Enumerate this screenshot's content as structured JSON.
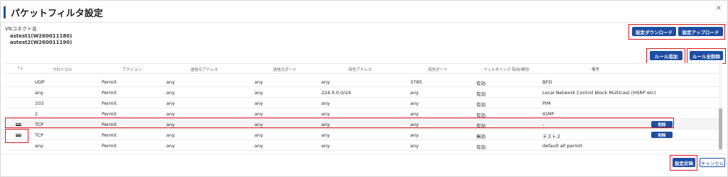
{
  "dialog": {
    "title": "パケットフィルタ設定",
    "close_label": "×"
  },
  "vn": {
    "label": "VNコネクト名",
    "items": [
      "astest1(W260011180)",
      "astest2(W260011190)"
    ]
  },
  "toolbar": {
    "download_label": "設定ダウンロード",
    "upload_label": "設定アップロード",
    "add_rule_label": "ルール追加",
    "delete_all_label": "ルール全削除"
  },
  "table": {
    "headers": {
      "sort": "↑↓",
      "protocol": "プロトコル",
      "action": "アクション",
      "src_addr": "送信元アドレス",
      "src_port": "送信元ポート",
      "dst_addr": "宛先アドレス",
      "dst_port": "宛先ポート",
      "filtering": "フィルタリング 有効/無効",
      "note": "備考"
    },
    "rows": [
      {
        "protocol": "UDP",
        "action": "Permit",
        "src_addr": "any",
        "src_port": "any",
        "dst_addr": "any",
        "dst_port": "3785",
        "filtering": "有効",
        "note": "BFD"
      },
      {
        "protocol": "any",
        "action": "Permit",
        "src_addr": "any",
        "src_port": "any",
        "dst_addr": "224.0.0.0/24",
        "dst_port": "any",
        "filtering": "有効",
        "note": "Local Network Control Block Multicast (HSRP etc)"
      },
      {
        "protocol": "103",
        "action": "Permit",
        "src_addr": "any",
        "src_port": "any",
        "dst_addr": "any",
        "dst_port": "any",
        "filtering": "有効",
        "note": "PIM"
      },
      {
        "protocol": "2",
        "action": "Permit",
        "src_addr": "any",
        "src_port": "any",
        "dst_addr": "any",
        "dst_port": "any",
        "filtering": "有効",
        "note": "IGMP"
      },
      {
        "protocol": "TCP",
        "action": "Permit",
        "src_addr": "any",
        "src_port": "any",
        "dst_addr": "any",
        "dst_port": "any",
        "filtering": "有効",
        "note": "-",
        "delete_label": "削除"
      },
      {
        "protocol": "TCP",
        "action": "Permit",
        "src_addr": "any",
        "src_port": "any",
        "dst_addr": "any",
        "dst_port": "any",
        "filtering": "無効",
        "note": "テスト２",
        "delete_label": "削除"
      },
      {
        "protocol": "any",
        "action": "Permit",
        "src_addr": "any",
        "src_port": "any",
        "dst_addr": "any",
        "dst_port": "any",
        "filtering": "有効",
        "note": "default all permit"
      }
    ]
  },
  "footer": {
    "apply_label": "設定反映",
    "cancel_label": "キャンセル"
  },
  "colors": {
    "primary": "#1e4da1",
    "highlight_frame": "#e0141e"
  }
}
